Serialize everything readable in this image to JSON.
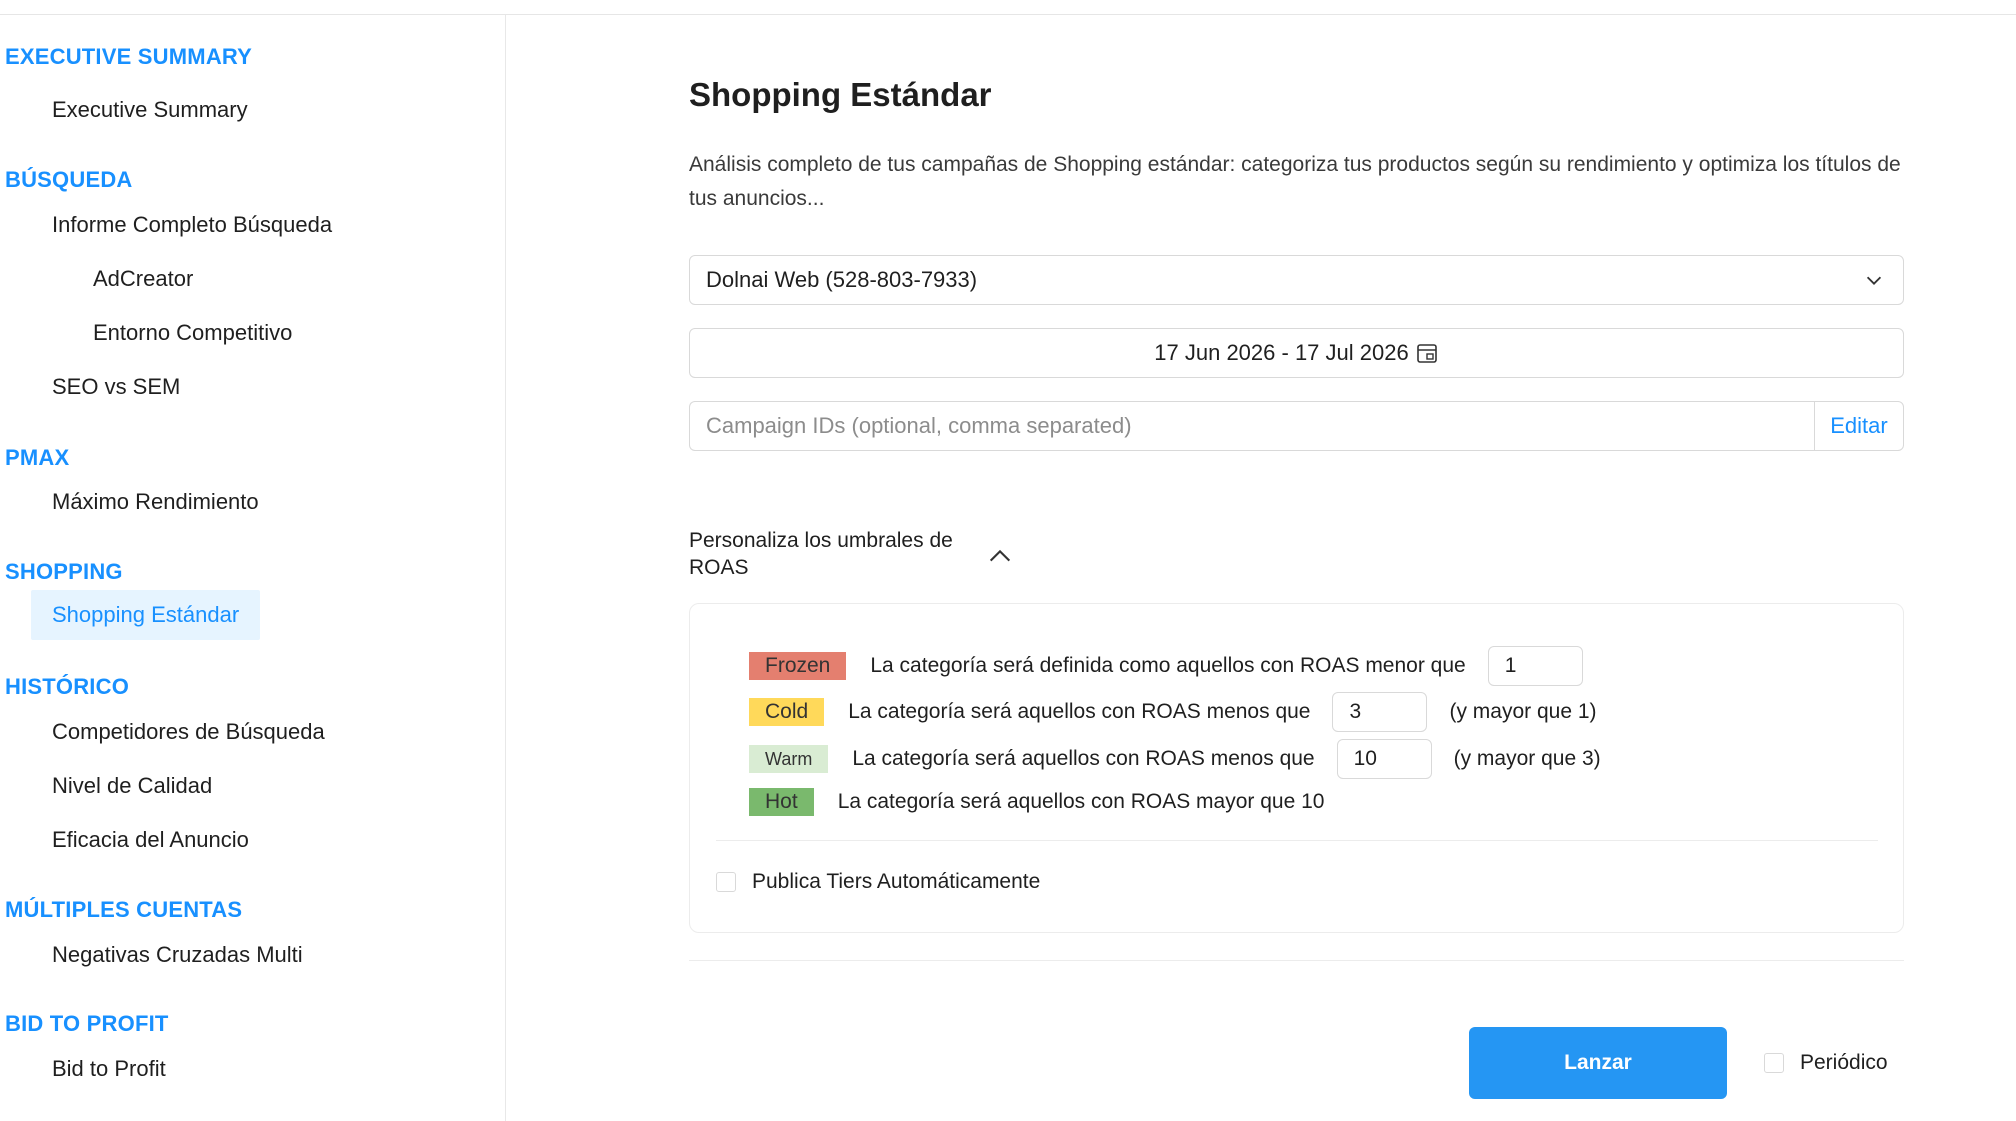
{
  "sidebar": {
    "sections": [
      {
        "title": "EXECUTIVE SUMMARY",
        "items": [
          "Executive Summary"
        ]
      },
      {
        "title": "BÚSQUEDA",
        "items": [
          "Informe Completo Búsqueda",
          "AdCreator",
          "Entorno Competitivo",
          "SEO vs SEM"
        ]
      },
      {
        "title": "PMAX",
        "items": [
          "Máximo Rendimiento"
        ]
      },
      {
        "title": "SHOPPING",
        "items": [
          "Shopping Estándar"
        ]
      },
      {
        "title": "HISTÓRICO",
        "items": [
          "Competidores de Búsqueda",
          "Nivel de Calidad",
          "Eficacia del Anuncio"
        ]
      },
      {
        "title": "MÚLTIPLES CUENTAS",
        "items": [
          "Negativas Cruzadas Multi"
        ]
      },
      {
        "title": "BID TO PROFIT",
        "items": [
          "Bid to Profit"
        ]
      }
    ],
    "active_item": "Shopping Estándar"
  },
  "main": {
    "title": "Shopping Estándar",
    "description": "Análisis completo de tus campañas de Shopping estándar: categoriza tus productos según su rendimiento y optimiza los títulos de tus anuncios...",
    "account_select": "Dolnai Web (528-803-7933)",
    "date_range": "17 Jun 2026 - 17 Jul 2026",
    "campaign_ids": {
      "placeholder": "Campaign IDs (optional, comma separated)",
      "button": "Editar"
    },
    "thresholds_header": "Personaliza los umbrales de ROAS",
    "tiers": {
      "frozen": {
        "label": "Frozen",
        "text": "La categoría será definida como aquellos con ROAS menor que",
        "value": "1",
        "color": "#e47f6f"
      },
      "cold": {
        "label": "Cold",
        "text": "La categoría será aquellos con ROAS menos que",
        "value": "3",
        "suffix": "(y mayor que 1)",
        "color": "#ffd95a"
      },
      "warm": {
        "label": "Warm",
        "text": "La categoría será aquellos con ROAS menos que",
        "value": "10",
        "suffix": "(y mayor que 3)",
        "color": "#d9ecd3"
      },
      "hot": {
        "label": "Hot",
        "text": "La categoría será aquellos con ROAS mayor que 10",
        "color": "#7ab96d"
      }
    },
    "auto_publish_label": "Publica Tiers Automáticamente",
    "launch_button": "Lanzar",
    "periodic_label": "Periódico"
  },
  "colors": {
    "accent": "#1890ff",
    "button": "#2596f3",
    "active_bg": "#e6f4ff"
  }
}
